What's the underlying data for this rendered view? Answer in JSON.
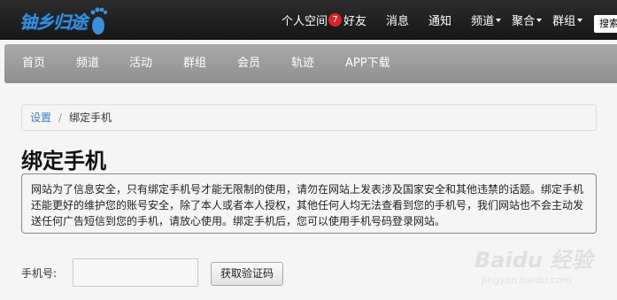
{
  "brand": {
    "logo_text": "铀乡归途"
  },
  "topnav": {
    "items": [
      {
        "label": "个人空间",
        "badge": "7"
      },
      {
        "label": "好友"
      },
      {
        "label": "消息"
      },
      {
        "label": "通知"
      },
      {
        "label": "频道",
        "dropdown": true
      },
      {
        "label": "聚合",
        "dropdown": true
      },
      {
        "label": "群组",
        "dropdown": true
      }
    ],
    "search_button": "搜索"
  },
  "mainnav": {
    "items": [
      "首页",
      "频道",
      "活动",
      "群组",
      "会员",
      "轨迹",
      "APP下载"
    ]
  },
  "breadcrumb": {
    "parent": "设置",
    "separator": "/",
    "current": "绑定手机"
  },
  "page": {
    "title": "绑定手机",
    "notice": "网站为了信息安全，只有绑定手机号才能无限制的使用，请勿在网站上发表涉及国家安全和其他违禁的话题。绑定手机还能更好的维护您的账号安全，除了本人或者本人授权，其他任何人均无法查看到您的手机号，我们网站也不会主动发送任何广告短信到您的手机，请放心使用。绑定手机后，您可以使用手机号码登录网站。"
  },
  "form": {
    "phone_label": "手机号:",
    "phone_value": "",
    "get_code_button": "获取验证码"
  },
  "watermark": {
    "main": "Baidu 经验",
    "sub": "jingyan.baidu.com"
  },
  "colors": {
    "topbar": "#1c1c1c",
    "navbar": "#9a9a9a",
    "link": "#3b7fc4",
    "badge": "#d9242a"
  }
}
